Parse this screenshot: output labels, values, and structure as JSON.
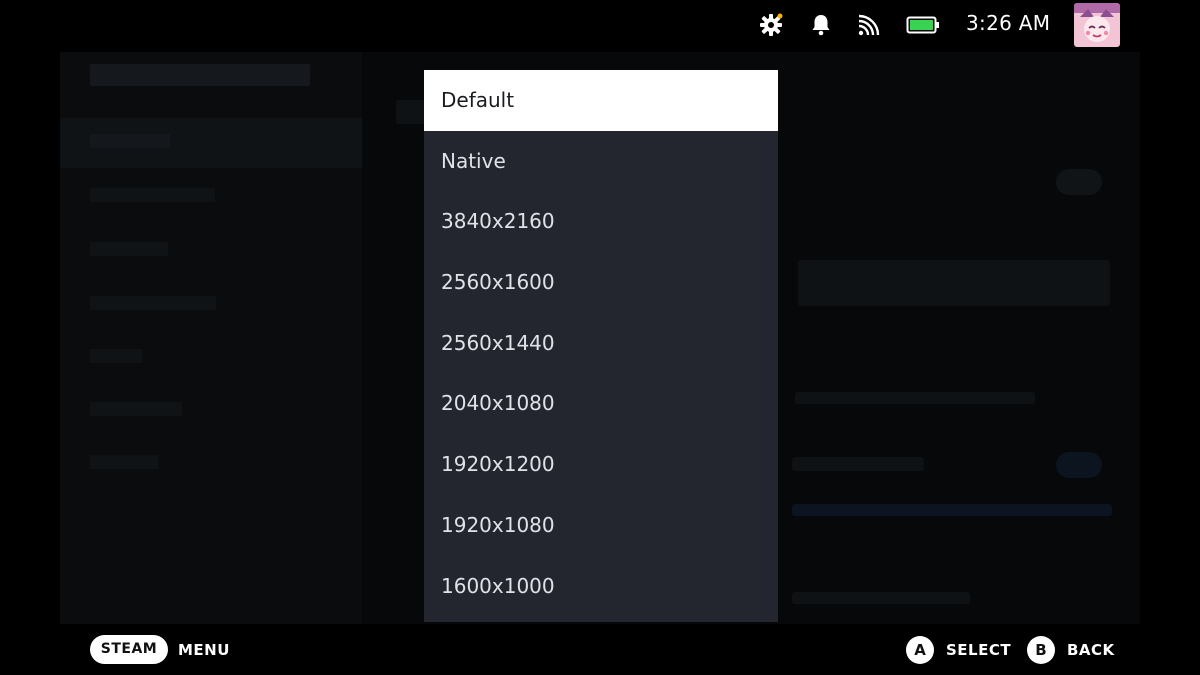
{
  "status_bar": {
    "time": "3:26 AM",
    "icons": [
      "settings-gear-icon",
      "notification-bell-icon",
      "wireless-signal-icon",
      "battery-icon"
    ],
    "battery_color": "#39d353"
  },
  "dropdown": {
    "options": [
      "Default",
      "Native",
      "3840x2160",
      "2560x1600",
      "2560x1440",
      "2040x1080",
      "1920x1200",
      "1920x1080",
      "1600x1000"
    ],
    "selected": "Default"
  },
  "footer": {
    "steam_label": "STEAM",
    "menu_label": "MENU",
    "a_glyph": "A",
    "select_label": "SELECT",
    "b_glyph": "B",
    "back_label": "BACK"
  },
  "colors": {
    "dropdown_bg": "#23262e",
    "selected_bg": "#ffffff",
    "page_bg": "#000000"
  }
}
